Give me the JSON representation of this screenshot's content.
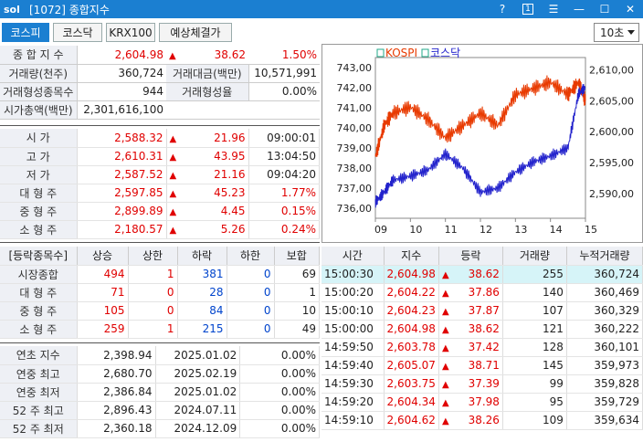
{
  "titlebar": {
    "logo": "sol",
    "title": "[1072] 종합지수",
    "help": "?",
    "box": "1"
  },
  "toolbar": {
    "tabs": [
      "코스피",
      "코스닥",
      "KRX100",
      "예상체결가"
    ],
    "interval": "10초"
  },
  "summary": {
    "rows": [
      {
        "l1": "종 합 지 수",
        "v1": "2,604.98",
        "v2": "38.62",
        "v3": "1.50%"
      },
      {
        "l1": "거래량(천주)",
        "v1": "360,724",
        "l2": "거래대금(백만)",
        "v2": "10,571,991"
      },
      {
        "l1": "거래형성종목수",
        "v1": "944",
        "l2": "거래형성율",
        "v2": "0.00%"
      },
      {
        "l1": "시가총액(백만)",
        "v1": "2,301,616,100"
      }
    ]
  },
  "ohlc": {
    "rows": [
      {
        "label": "시 가",
        "value": "2,588.32",
        "change": "21.96",
        "extra": "09:00:01"
      },
      {
        "label": "고 가",
        "value": "2,610.31",
        "change": "43.95",
        "extra": "13:04:50"
      },
      {
        "label": "저 가",
        "value": "2,587.52",
        "change": "21.16",
        "extra": "09:04:20"
      },
      {
        "label": "대 형 주",
        "value": "2,597.85",
        "change": "45.23",
        "extra": "1.77%"
      },
      {
        "label": "중 형 주",
        "value": "2,899.89",
        "change": "4.45",
        "extra": "0.15%"
      },
      {
        "label": "소 형 주",
        "value": "2,180.57",
        "change": "5.26",
        "extra": "0.24%"
      }
    ]
  },
  "breadth": {
    "headers": [
      "[등락종목수]",
      "상승",
      "상한",
      "하락",
      "하한",
      "보합"
    ],
    "rows": [
      {
        "label": "시장종합",
        "v": [
          "494",
          "1",
          "381",
          "0",
          "69"
        ]
      },
      {
        "label": "대 형 주",
        "v": [
          "71",
          "0",
          "28",
          "0",
          "1"
        ]
      },
      {
        "label": "중 형 주",
        "v": [
          "105",
          "0",
          "84",
          "0",
          "10"
        ]
      },
      {
        "label": "소 형 주",
        "v": [
          "259",
          "1",
          "215",
          "0",
          "49"
        ]
      }
    ]
  },
  "yearly": {
    "rows": [
      {
        "label": "연초 지수",
        "value": "2,398.94",
        "date": "2025.01.02",
        "pct": "0.00%"
      },
      {
        "label": "연중 최고",
        "value": "2,680.70",
        "date": "2025.02.19",
        "pct": "0.00%"
      },
      {
        "label": "연중 최저",
        "value": "2,386.84",
        "date": "2025.01.02",
        "pct": "0.00%"
      },
      {
        "label": "52 주 최고",
        "value": "2,896.43",
        "date": "2024.07.11",
        "pct": "0.00%"
      },
      {
        "label": "52 주 최저",
        "value": "2,360.18",
        "date": "2024.12.09",
        "pct": "0.00%"
      }
    ]
  },
  "ticks": {
    "headers": [
      "시간",
      "지수",
      "등락",
      "거래량",
      "누적거래량"
    ],
    "rows": [
      {
        "t": "15:00:30",
        "idx": "2,604.98",
        "chg": "38.62",
        "vol": "255",
        "cum": "360,724"
      },
      {
        "t": "15:00:20",
        "idx": "2,604.22",
        "chg": "37.86",
        "vol": "140",
        "cum": "360,469"
      },
      {
        "t": "15:00:10",
        "idx": "2,604.23",
        "chg": "37.87",
        "vol": "107",
        "cum": "360,329"
      },
      {
        "t": "15:00:00",
        "idx": "2,604.98",
        "chg": "38.62",
        "vol": "121",
        "cum": "360,222"
      },
      {
        "t": "14:59:50",
        "idx": "2,603.78",
        "chg": "37.42",
        "vol": "128",
        "cum": "360,101"
      },
      {
        "t": "14:59:40",
        "idx": "2,605.07",
        "chg": "38.71",
        "vol": "145",
        "cum": "359,973"
      },
      {
        "t": "14:59:30",
        "idx": "2,603.75",
        "chg": "37.39",
        "vol": "99",
        "cum": "359,828"
      },
      {
        "t": "14:59:20",
        "idx": "2,604.34",
        "chg": "37.98",
        "vol": "95",
        "cum": "359,729"
      },
      {
        "t": "14:59:10",
        "idx": "2,604.62",
        "chg": "38.26",
        "vol": "109",
        "cum": "359,634"
      }
    ]
  },
  "chart_data": {
    "type": "line",
    "legend": [
      "KOSPI",
      "코스닥"
    ],
    "x_ticks": [
      "09",
      "10",
      "11",
      "12",
      "13",
      "14",
      "15"
    ],
    "left_axis": {
      "ticks": [
        "743,00",
        "742,00",
        "741,00",
        "740,00",
        "739,00",
        "738,00",
        "737,00",
        "736,00"
      ],
      "range": [
        735.5,
        743.5
      ]
    },
    "right_axis": {
      "ticks": [
        "2,610,00",
        "2,605,00",
        "2,600,00",
        "2,595,00",
        "2,590,00"
      ],
      "range": [
        2586,
        2612
      ]
    },
    "series": [
      {
        "name": "KOSPI",
        "color": "#e83a00",
        "axis": "right",
        "x": [
          9,
          9.25,
          9.5,
          10,
          10.5,
          11,
          11.5,
          12,
          12.5,
          13,
          13.5,
          14,
          14.5,
          14.8,
          15
        ],
        "values": [
          2596,
          2601,
          2603,
          2604,
          2602,
          2599,
          2601,
          2603,
          2601,
          2606,
          2607,
          2608,
          2606,
          2608,
          2604.98
        ]
      },
      {
        "name": "코스닥",
        "color": "#2222cc",
        "axis": "left",
        "x": [
          9,
          9.25,
          9.5,
          10,
          10.5,
          11,
          11.5,
          12,
          12.5,
          13,
          13.5,
          14,
          14.5,
          14.8,
          15
        ],
        "values": [
          736.3,
          736.8,
          737.4,
          737.6,
          737.9,
          738.7,
          738.0,
          736.8,
          737.0,
          737.8,
          738.3,
          738.6,
          739.0,
          741.7,
          742.0
        ]
      }
    ]
  }
}
